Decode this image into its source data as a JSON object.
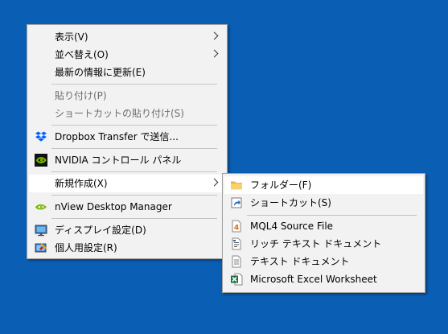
{
  "context_menu": {
    "items": [
      {
        "label": "表示(V)"
      },
      {
        "label": "並べ替え(O)"
      },
      {
        "label": "最新の情報に更新(E)"
      },
      {
        "label": "貼り付け(P)"
      },
      {
        "label": "ショートカットの貼り付け(S)"
      },
      {
        "label": "Dropbox Transfer で送信...",
        "icon": "dropbox-icon"
      },
      {
        "label": "NVIDIA コントロール パネル",
        "icon": "nvidia-icon"
      },
      {
        "label": "新規作成(X)"
      },
      {
        "label": "nView Desktop Manager",
        "icon": "nview-icon"
      },
      {
        "label": "ディスプレイ設定(D)",
        "icon": "display-icon"
      },
      {
        "label": "個人用設定(R)",
        "icon": "personalize-icon"
      }
    ]
  },
  "submenu": {
    "items": [
      {
        "label": "フォルダー(F)",
        "icon": "folder-icon"
      },
      {
        "label": "ショートカット(S)",
        "icon": "shortcut-icon"
      },
      {
        "label": "MQL4 Source File",
        "icon": "mql4-file-icon"
      },
      {
        "label": "リッチ テキスト ドキュメント",
        "icon": "rich-text-icon"
      },
      {
        "label": "テキスト ドキュメント",
        "icon": "text-document-icon"
      },
      {
        "label": "Microsoft Excel Worksheet",
        "icon": "excel-icon"
      }
    ]
  },
  "colors": {
    "desktop": "#0a5fb4",
    "menu_background": "#f2f2f2",
    "highlight": "#ffffff",
    "disabled_text": "#6d6d6d"
  }
}
